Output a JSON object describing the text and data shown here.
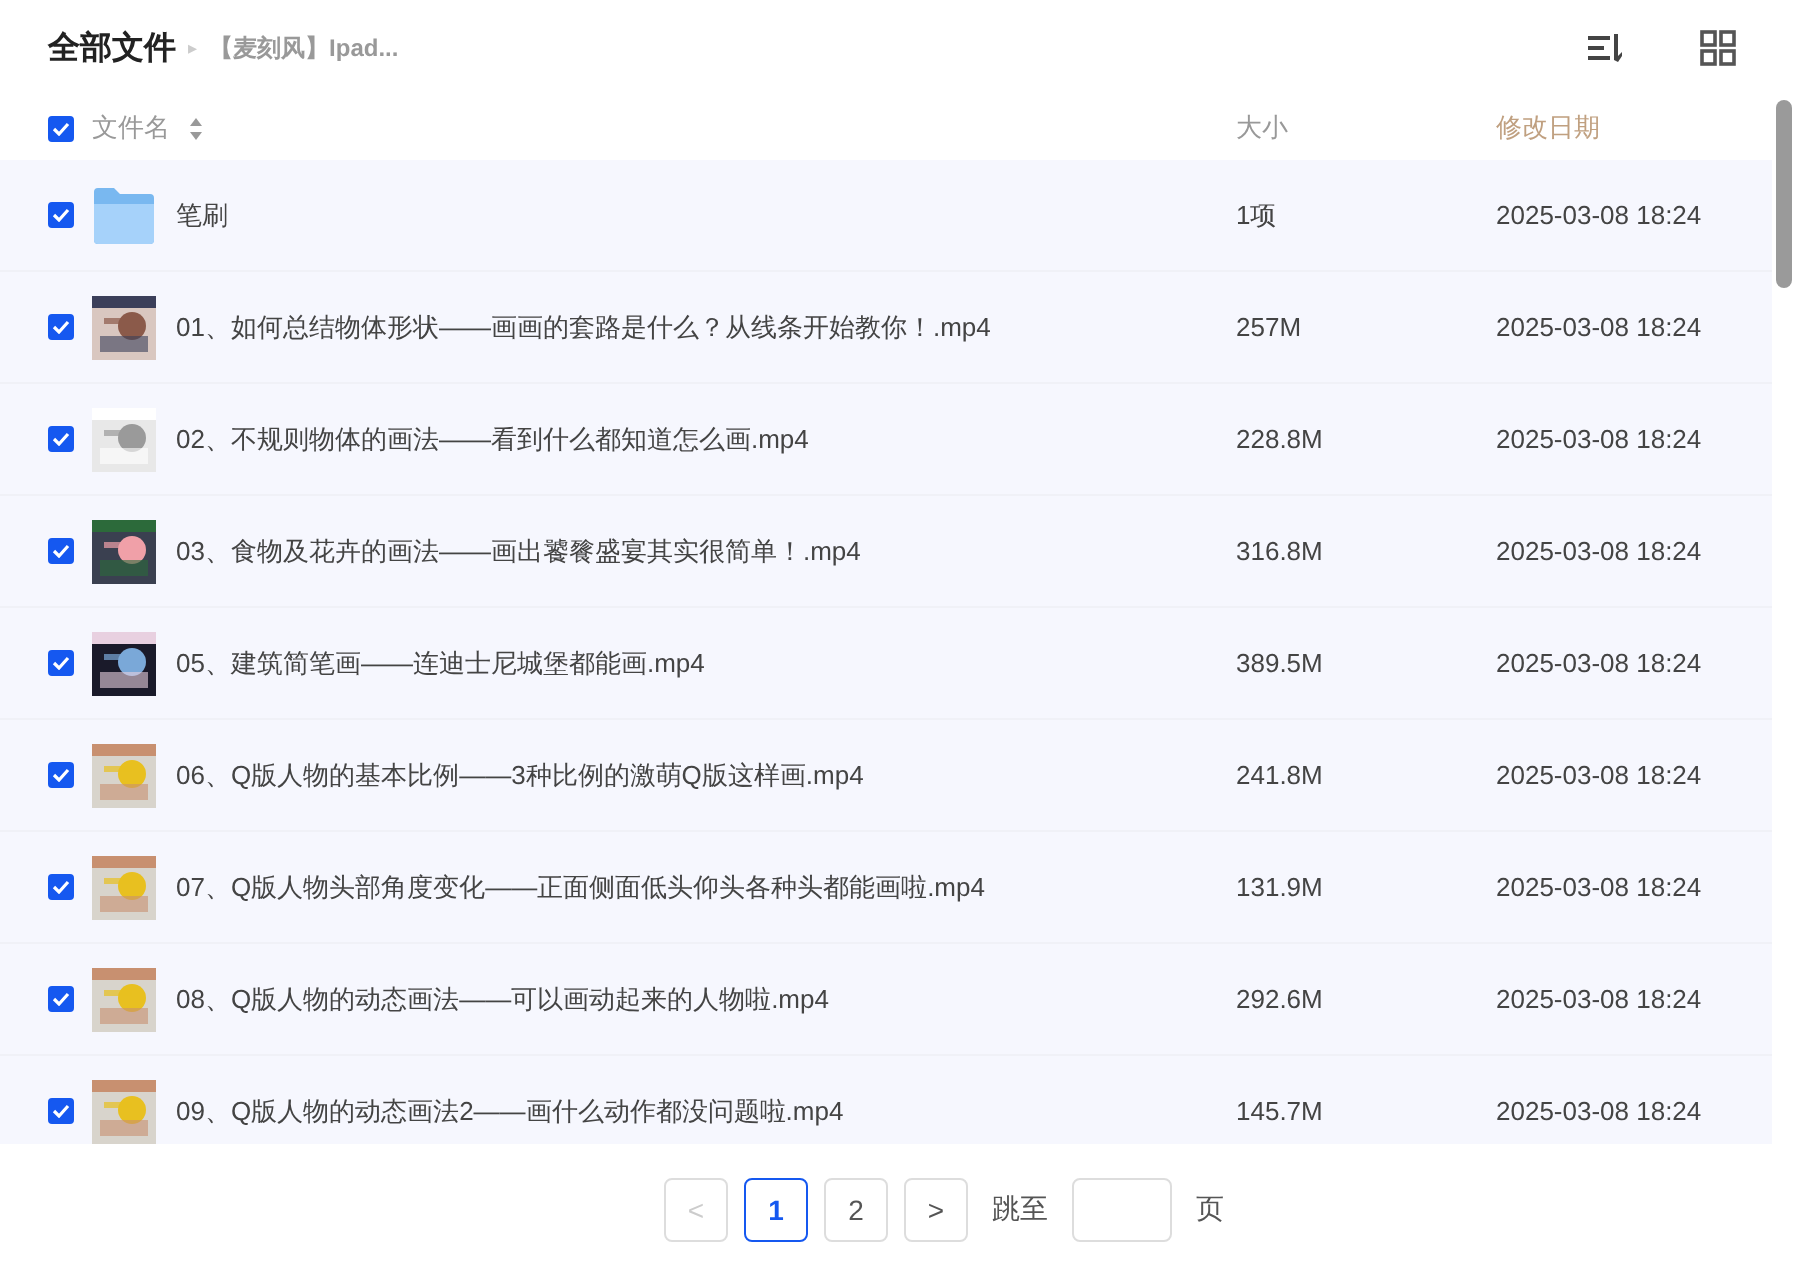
{
  "breadcrumb": {
    "root": "全部文件",
    "separator": "▸",
    "current": "【麦刻风】Ipad..."
  },
  "header": {
    "all_checked": true,
    "columns": [
      "文件名",
      "大小",
      "修改日期"
    ]
  },
  "rows": [
    {
      "kind": "folder",
      "checked": true,
      "name": "笔刷",
      "size": "1项",
      "date": "2025-03-08 18:24"
    },
    {
      "kind": "video",
      "checked": true,
      "name": "01、如何总结物体形状——画画的套路是什么？从线条开始教你！.mp4",
      "size": "257M",
      "date": "2025-03-08 18:24"
    },
    {
      "kind": "video",
      "checked": true,
      "name": "02、不规则物体的画法——看到什么都知道怎么画.mp4",
      "size": "228.8M",
      "date": "2025-03-08 18:24"
    },
    {
      "kind": "video",
      "checked": true,
      "name": "03、食物及花卉的画法——画出饕餮盛宴其实很简单！.mp4",
      "size": "316.8M",
      "date": "2025-03-08 18:24"
    },
    {
      "kind": "video",
      "checked": true,
      "name": "05、建筑简笔画——连迪士尼城堡都能画.mp4",
      "size": "389.5M",
      "date": "2025-03-08 18:24"
    },
    {
      "kind": "video",
      "checked": true,
      "name": "06、Q版人物的基本比例——3种比例的激萌Q版这样画.mp4",
      "size": "241.8M",
      "date": "2025-03-08 18:24"
    },
    {
      "kind": "video",
      "checked": true,
      "name": "07、Q版人物头部角度变化——正面侧面低头仰头各种头都能画啦.mp4",
      "size": "131.9M",
      "date": "2025-03-08 18:24"
    },
    {
      "kind": "video",
      "checked": true,
      "name": "08、Q版人物的动态画法——可以画动起来的人物啦.mp4",
      "size": "292.6M",
      "date": "2025-03-08 18:24"
    },
    {
      "kind": "video",
      "checked": true,
      "name": "09、Q版人物的动态画法2——画什么动作都没问题啦.mp4",
      "size": "145.7M",
      "date": "2025-03-08 18:24"
    }
  ],
  "pagination": {
    "prev": "<",
    "next": ">",
    "prev_disabled": true,
    "pages": [
      {
        "label": "1",
        "selected": true
      },
      {
        "label": "2",
        "selected": false
      }
    ],
    "jump_label": "跳至",
    "page_unit": "页"
  }
}
